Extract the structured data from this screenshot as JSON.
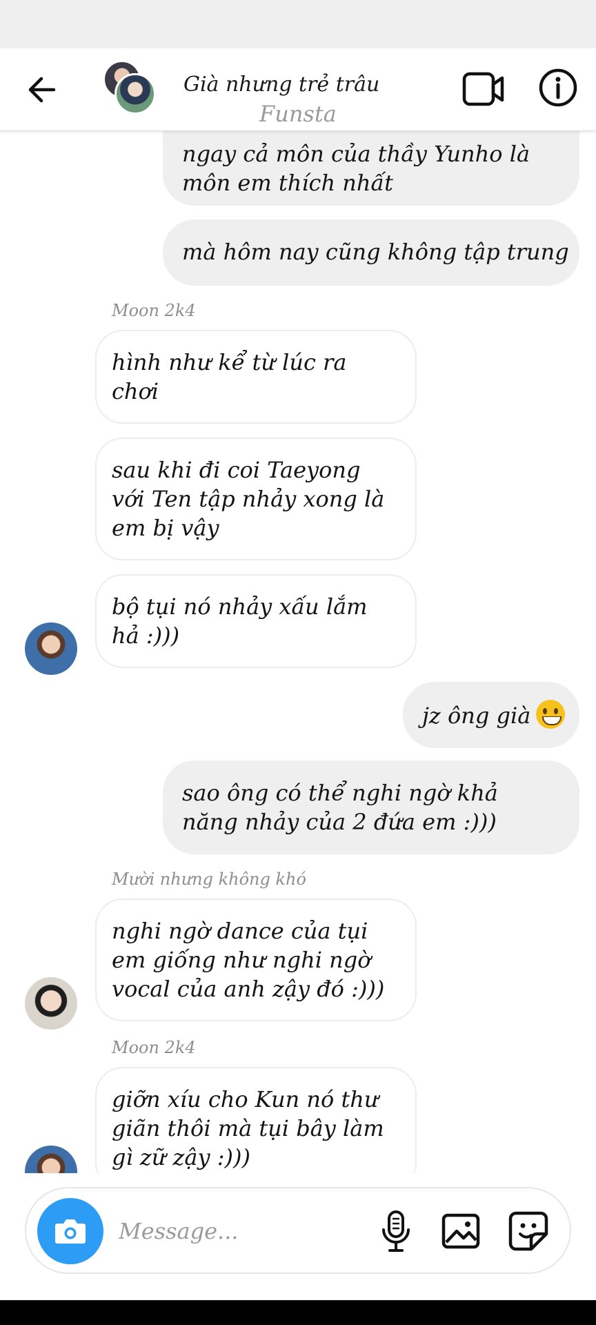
{
  "header": {
    "title": "Già nhưng trẻ trâu",
    "subtitle": "Funsta"
  },
  "messages": [
    {
      "type": "outgoing",
      "text": "ngay cả môn của thầy Yunho là môn em thích nhất"
    },
    {
      "type": "outgoing",
      "text": "mà hôm nay cũng không tập trung"
    },
    {
      "type": "sender",
      "text": "Moon 2k4"
    },
    {
      "type": "incoming",
      "text": "hình như kể từ lúc ra chơi"
    },
    {
      "type": "incoming",
      "text": "sau khi đi coi Taeyong với Ten tập nhảy xong là em bị vậy"
    },
    {
      "type": "incoming",
      "text": "bộ tụi nó nhảy xấu lắm hả :)))"
    },
    {
      "type": "outgoing",
      "text": "jz ông già"
    },
    {
      "type": "outgoing",
      "text": "sao ông có thể nghi ngờ khả năng nhảy của 2 đứa em :)))"
    },
    {
      "type": "sender",
      "text": "Mười nhưng không khó"
    },
    {
      "type": "incoming",
      "text": "nghi ngờ dance của tụi em giống như nghi ngờ vocal của anh zậy đó :)))"
    },
    {
      "type": "sender",
      "text": "Moon 2k4"
    },
    {
      "type": "incoming",
      "text": "giỡn xíu cho Kun nó thư giãn thôi mà tụi bây làm gì zữ zậy :)))"
    }
  ],
  "composer": {
    "placeholder": "Message..."
  },
  "icons": {
    "back": "arrow-left-icon",
    "video": "video-camera-icon",
    "info": "info-icon",
    "camera": "camera-icon",
    "mic": "microphone-icon",
    "gallery": "image-icon",
    "sticker": "sticker-icon",
    "emoji": "grinning-face-emoji"
  },
  "colors": {
    "outgoing_bubble": "#efefef",
    "incoming_border": "#ececec",
    "camera_button": "#2d9cf4",
    "sender_name": "#8e8e8e",
    "subtitle": "#9a9a9a"
  }
}
